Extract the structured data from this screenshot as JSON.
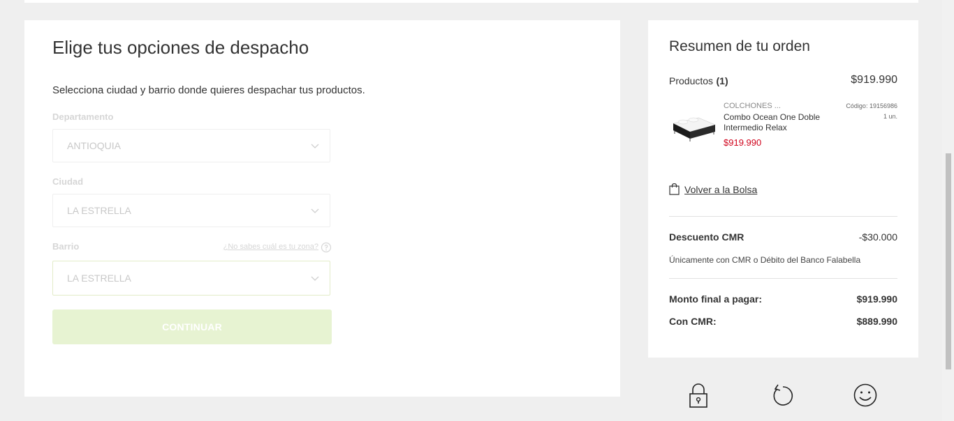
{
  "shipping": {
    "title": "Elige tus opciones de despacho",
    "subtitle": "Selecciona ciudad y barrio donde quieres despachar tus productos.",
    "department_label": "Departamento",
    "department_value": "ANTIOQUIA",
    "city_label": "Ciudad",
    "city_value": "LA ESTRELLA",
    "neighborhood_label": "Barrio",
    "neighborhood_value": "LA ESTRELLA",
    "help_link": "¿No sabes cuál es tu zona?",
    "continue_label": "CONTINUAR"
  },
  "summary": {
    "title": "Resumen de tu orden",
    "products_label": "Productos",
    "products_count": "(1)",
    "products_total": "$919.990",
    "item": {
      "brand": "COLCHONES ...",
      "name": "Combo Ocean One Doble Intermedio Relax",
      "price": "$919.990",
      "code": "Código: 19156986",
      "quantity": "1 un."
    },
    "back_link": "Volver a la Bolsa",
    "discount_label": "Descuento CMR",
    "discount_value": "-$30.000",
    "discount_note": "Únicamente con CMR o Débito del Banco Falabella",
    "final_label": "Monto final a pagar:",
    "final_value": "$919.990",
    "cmr_label": "Con CMR:",
    "cmr_value": "$889.990"
  },
  "icons": [
    "lock-icon",
    "refresh-icon",
    "smiley-icon",
    "chevron-down-icon",
    "help-circle-icon",
    "shopping-bag-icon"
  ],
  "colors": {
    "price_red": "#d0021b",
    "button_disabled": "#e7f3d2",
    "background": "#efefef"
  }
}
